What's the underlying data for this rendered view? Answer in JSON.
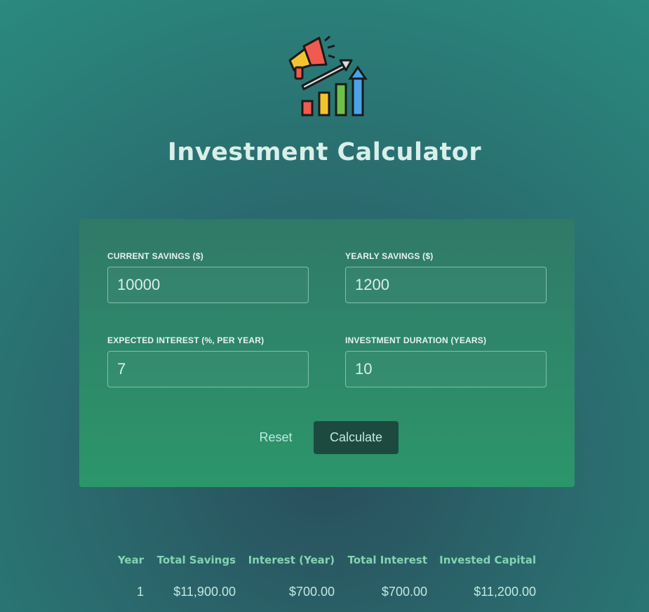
{
  "header": {
    "logo_icon": "investment-growth-chart-megaphone-icon",
    "title": "Investment Calculator"
  },
  "form": {
    "fields": [
      {
        "label": "CURRENT SAVINGS ($)",
        "value": "10000"
      },
      {
        "label": "YEARLY SAVINGS ($)",
        "value": "1200"
      },
      {
        "label": "EXPECTED INTEREST (%, PER YEAR)",
        "value": "7"
      },
      {
        "label": "INVESTMENT DURATION (YEARS)",
        "value": "10"
      }
    ],
    "reset_label": "Reset",
    "calculate_label": "Calculate"
  },
  "results": {
    "columns": [
      "Year",
      "Total Savings",
      "Interest (Year)",
      "Total Interest",
      "Invested Capital"
    ],
    "rows": [
      [
        "1",
        "$11,900.00",
        "$700.00",
        "$700.00",
        "$11,200.00"
      ]
    ]
  },
  "colors": {
    "background_top": "#2a8a7f",
    "background_center": "#294e5b",
    "card_top": "#307968",
    "card_bottom": "#2c966b",
    "button_dark": "#1d4a3f",
    "header_text": "#84d4b3"
  }
}
